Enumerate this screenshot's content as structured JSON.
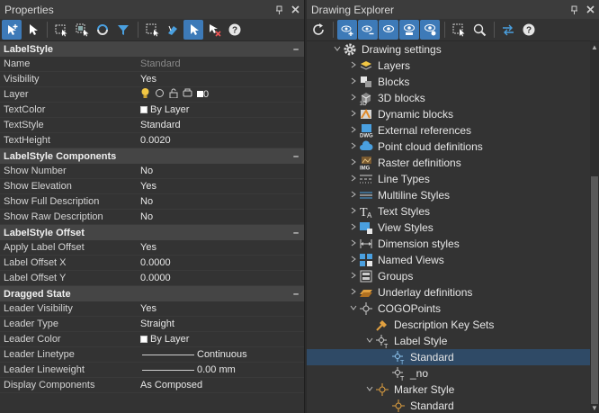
{
  "properties": {
    "title": "Properties",
    "pin": "❘",
    "close": "✕",
    "sections": [
      {
        "label": "LabelStyle",
        "rows": [
          {
            "name": "Name",
            "value": "Standard",
            "dim": true
          },
          {
            "name": "Visibility",
            "value": "Yes"
          },
          {
            "name": "Layer",
            "value": "0",
            "kind": "layer"
          },
          {
            "name": "TextColor",
            "value": "By Layer",
            "kind": "color"
          },
          {
            "name": "TextStyle",
            "value": "Standard"
          },
          {
            "name": "TextHeight",
            "value": "0.0020"
          }
        ]
      },
      {
        "label": "LabelStyle Components",
        "rows": [
          {
            "name": "Show Number",
            "value": "No"
          },
          {
            "name": "Show Elevation",
            "value": "Yes"
          },
          {
            "name": "Show Full Description",
            "value": "No"
          },
          {
            "name": "Show Raw Description",
            "value": "No"
          }
        ]
      },
      {
        "label": "LabelStyle Offset",
        "rows": [
          {
            "name": "Apply Label Offset",
            "value": "Yes"
          },
          {
            "name": "Label Offset X",
            "value": "0.0000"
          },
          {
            "name": "Label Offset Y",
            "value": "0.0000"
          }
        ]
      },
      {
        "label": "Dragged State",
        "rows": [
          {
            "name": "Leader Visibility",
            "value": "Yes"
          },
          {
            "name": "Leader Type",
            "value": "Straight"
          },
          {
            "name": "Leader Color",
            "value": "By Layer",
            "kind": "color"
          },
          {
            "name": "Leader Linetype",
            "value": "Continuous",
            "kind": "line"
          },
          {
            "name": "Leader Lineweight",
            "value": "0.00 mm",
            "kind": "line"
          },
          {
            "name": "Display Components",
            "value": "As Composed"
          }
        ]
      }
    ],
    "collapse_glyph": "–"
  },
  "explorer": {
    "title": "Drawing Explorer",
    "pin": "❘",
    "close": "✕",
    "root": "Drawing settings",
    "items": [
      {
        "label": "Layers",
        "icon": "layers-icon",
        "color": "#f2c744"
      },
      {
        "label": "Blocks",
        "icon": "blocks-icon",
        "color": "#e6e6e6"
      },
      {
        "label": "3D blocks",
        "icon": "3d-blocks-icon",
        "color": "#d0d0d0"
      },
      {
        "label": "Dynamic blocks",
        "icon": "dynamic-blocks-icon",
        "color": "#e08a2a"
      },
      {
        "label": "External references",
        "icon": "external-references-icon",
        "color": "#4aa0e0",
        "badge": "DWG"
      },
      {
        "label": "Point cloud definitions",
        "icon": "point-cloud-icon",
        "color": "#4aa0e0"
      },
      {
        "label": "Raster definitions",
        "icon": "raster-icon",
        "color": "#8a6a3a",
        "badge": "IMG"
      },
      {
        "label": "Line Types",
        "icon": "line-types-icon",
        "color": "#cfcfcf"
      },
      {
        "label": "Multiline Styles",
        "icon": "multiline-styles-icon",
        "color": "#4aa0e0"
      },
      {
        "label": "Text Styles",
        "icon": "text-styles-icon",
        "color": "#e6e6e6"
      },
      {
        "label": "View Styles",
        "icon": "view-styles-icon",
        "color": "#4aa0e0"
      },
      {
        "label": "Dimension styles",
        "icon": "dimension-styles-icon",
        "color": "#cfcfcf"
      },
      {
        "label": "Named Views",
        "icon": "named-views-icon",
        "color": "#4aa0e0"
      },
      {
        "label": "Groups",
        "icon": "groups-icon",
        "color": "#cfcfcf"
      },
      {
        "label": "Underlay definitions",
        "icon": "underlay-icon",
        "color": "#e0a040"
      }
    ],
    "cogo": {
      "label": "COGOPoints",
      "children": [
        {
          "label": "Description Key Sets"
        },
        {
          "label": "Label Style",
          "children": [
            {
              "label": "Standard",
              "selected": true
            },
            {
              "label": "_no"
            }
          ]
        },
        {
          "label": "Marker Style",
          "children": [
            {
              "label": "Standard"
            }
          ]
        }
      ]
    }
  },
  "colors": {
    "accent": "#3d7ab8",
    "selection": "#2f4a66",
    "panel": "#333333"
  }
}
